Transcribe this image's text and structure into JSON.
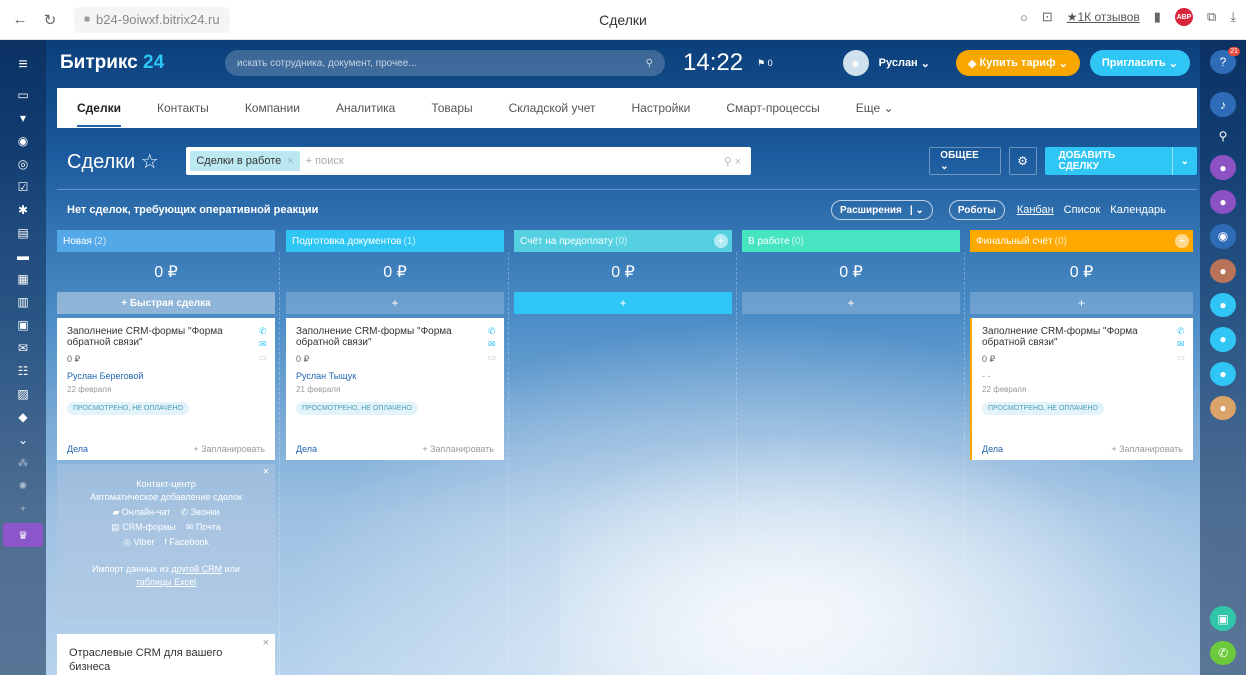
{
  "browser": {
    "url": "b24-9oiwxf.bitrix24.ru",
    "tab_title": "Сделки",
    "reviews_label": "★1К отзывов",
    "abp_label": "ABP"
  },
  "app": {
    "logo_name": "Битрикс",
    "logo_num": " 24",
    "search_placeholder": "искать сотрудника, документ, прочее...",
    "clock": "14:22",
    "flag_count": "0",
    "user_name": "Руслан",
    "buy_tariff_label": "Купить тариф",
    "invite_label": "Пригласить",
    "help_badge": "21"
  },
  "menu": {
    "items": [
      {
        "label": "Сделки"
      },
      {
        "label": "Контакты"
      },
      {
        "label": "Компании"
      },
      {
        "label": "Аналитика"
      },
      {
        "label": "Товары"
      },
      {
        "label": "Складской учет"
      },
      {
        "label": "Настройки"
      },
      {
        "label": "Смарт-процессы"
      },
      {
        "label": "Еще ⌄"
      }
    ]
  },
  "toolbar": {
    "page_title": "Сделки ☆",
    "filter_chip": "Сделки в работе",
    "search_placeholder": "+ поиск",
    "general_label": "ОБЩЕЕ ⌄",
    "add_deal_label": "ДОБАВИТЬ СДЕЛКУ"
  },
  "notice": {
    "text": "Нет сделок, требующих оперативной реакции",
    "extensions_label": "Расширения",
    "robots_label": "Роботы",
    "views": [
      "Канбан",
      "Список",
      "Календарь"
    ]
  },
  "columns": [
    {
      "title": "Новая",
      "count": "(2)",
      "sum": "0 ₽",
      "quick": "+ Быстрая сделка",
      "color": "#53a9e8"
    },
    {
      "title": "Подготовка документов",
      "count": "(1)",
      "sum": "0 ₽",
      "quick": "+",
      "color": "#2fc6f6"
    },
    {
      "title": "Счёт на предоплату",
      "count": "(0)",
      "sum": "0 ₽",
      "quick": "+",
      "color": "#55d0e0"
    },
    {
      "title": "В работе",
      "count": "(0)",
      "sum": "0 ₽",
      "quick": "+",
      "color": "#47e4c2"
    },
    {
      "title": "Финальный счёт",
      "count": "(0)",
      "sum": "0 ₽",
      "quick": "+",
      "color": "#ffa900"
    }
  ],
  "cards": [
    {
      "title": "Заполнение CRM-формы \"Форма обратной связи\"",
      "amount": "0 ₽",
      "person": "Руслан Береговой",
      "date": "22 февраля",
      "status": "ПРОСМОТРЕНО, НЕ ОПЛАЧЕНО",
      "deals": "Дела",
      "plan": "+ Запланировать"
    },
    {
      "title": "Заполнение CRM-формы \"Форма обратной связи\"",
      "amount": "0 ₽",
      "person": "Руслан Тыщук",
      "date": "21 февраля",
      "status": "ПРОСМОТРЕНО, НЕ ОПЛАЧЕНО",
      "deals": "Дела",
      "plan": "+ Запланировать"
    },
    {
      "title": "Заполнение CRM-формы \"Форма обратной связи\"",
      "amount": "0 ₽",
      "person": "- -",
      "date": "22 февраля",
      "status": "ПРОСМОТРЕНО, НЕ ОПЛАЧЕНО",
      "deals": "Дела",
      "plan": "+ Запланировать"
    }
  ],
  "promo": {
    "title1": "Контакт-центр",
    "title2": "Автоматическое добавление сделок",
    "online_chat": "Онлайн-чат",
    "calls": "Звонки",
    "crm_forms": "CRM-формы",
    "mail": "Почта",
    "viber": "Viber",
    "facebook": "Facebook",
    "import_prefix": "Импорт данных из ",
    "import_link": "другой CRM",
    "import_mid": " или",
    "import_link2": "таблицы Excel"
  },
  "promo2": {
    "text": "Отраслевые CRM для вашего бизнеса"
  }
}
